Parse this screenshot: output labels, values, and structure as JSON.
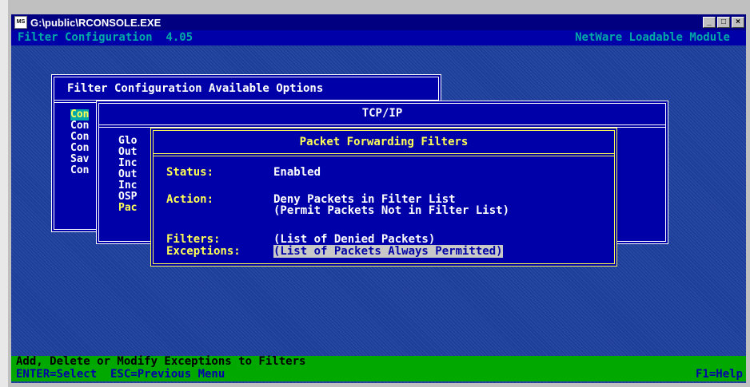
{
  "window": {
    "title": "G:\\public\\RCONSOLE.EXE",
    "icon_text": "MS",
    "buttons": [
      "_",
      "□",
      "×"
    ]
  },
  "header": {
    "left": "Filter Configuration  4.05",
    "right": "NetWare Loadable Module"
  },
  "available_options": {
    "title": "Filter Configuration Available Options",
    "items": [
      "Con",
      "Con",
      "Con",
      "Con",
      "Sav",
      "Con"
    ]
  },
  "tcpip": {
    "title": "TCP/IP",
    "items": [
      "Glo",
      "Out",
      "Inc",
      "Out",
      "Inc",
      "OSP",
      "Pac"
    ]
  },
  "packet_forwarding": {
    "title": "Packet Forwarding Filters",
    "status_label": "Status:",
    "status_value": "Enabled",
    "action_label": "Action:",
    "action_value_1": "Deny Packets in Filter List",
    "action_value_2": "(Permit Packets Not in Filter List)",
    "filters_label": "Filters:",
    "filters_value": "(List of Denied Packets)",
    "exceptions_label": "Exceptions:",
    "exceptions_value": "(List of Packets Always Permitted)"
  },
  "footer": {
    "hint": "Add, Delete or Modify Exceptions to Filters",
    "keys": "ENTER=Select  ESC=Previous Menu",
    "help": "F1=Help"
  },
  "colors": {
    "console_bg": "#1c3d9a",
    "box_bg": "#0000a8",
    "active_border": "#ffff55",
    "footer_bg": "#00a800"
  }
}
